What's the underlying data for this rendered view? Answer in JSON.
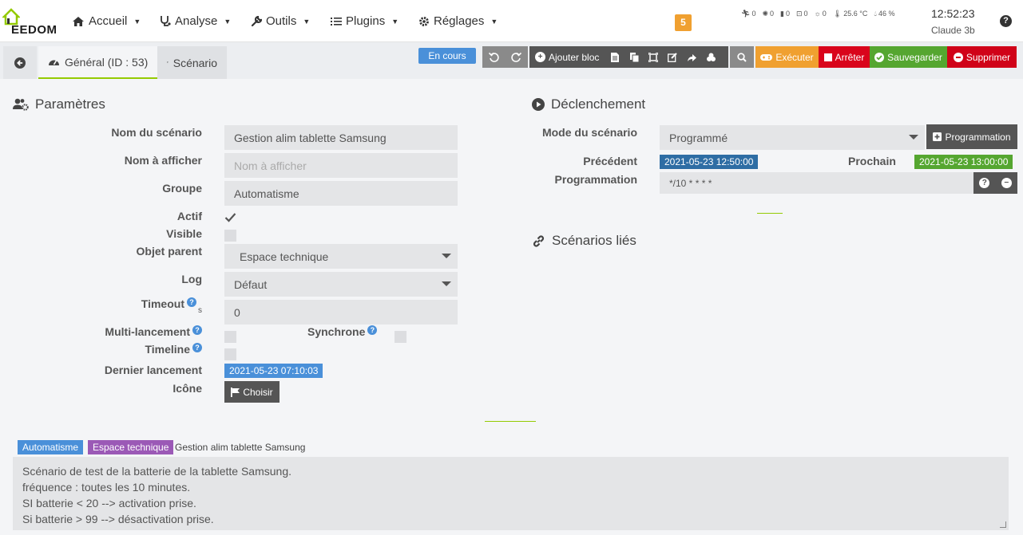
{
  "nav": {
    "logo_text": "EEDOM",
    "items": [
      {
        "label": "Accueil",
        "icon": "home-icon"
      },
      {
        "label": "Analyse",
        "icon": "stethoscope-icon"
      },
      {
        "label": "Outils",
        "icon": "wrench-icon"
      },
      {
        "label": "Plugins",
        "icon": "list-icon"
      },
      {
        "label": "Réglages",
        "icon": "cogs-icon"
      }
    ],
    "message_count": "5",
    "status": [
      {
        "icon": "motion-icon",
        "value": "0"
      },
      {
        "icon": "light-icon",
        "value": "0"
      },
      {
        "icon": "door-icon",
        "value": "0"
      },
      {
        "icon": "window-icon",
        "value": "0"
      },
      {
        "icon": "bulb-icon",
        "value": "0"
      },
      {
        "icon": "thermometer-icon",
        "value": "25.6 °C"
      },
      {
        "icon": "humidity-icon",
        "value": "46 %"
      }
    ],
    "clock": "12:52:23",
    "user": "Claude 3b",
    "help": "?"
  },
  "tabs": {
    "general": "Général (ID : 53)",
    "scenario": "Scénario"
  },
  "toolbar": {
    "state": "En cours",
    "add_block": "Ajouter bloc",
    "execute": "Exécuter",
    "stop": "Arrêter",
    "save": "Sauvegarder",
    "delete": "Supprimer"
  },
  "parametres": {
    "title": "Paramètres",
    "name_label": "Nom du scénario",
    "name_value": "Gestion alim tablette Samsung",
    "display_label": "Nom à afficher",
    "display_placeholder": "Nom à afficher",
    "group_label": "Groupe",
    "group_value": "Automatisme",
    "active_label": "Actif",
    "visible_label": "Visible",
    "parent_label": "Objet parent",
    "parent_value": "Espace technique",
    "log_label": "Log",
    "log_value": "Défaut",
    "timeout_label": "Timeout",
    "timeout_unit": "s",
    "timeout_value": "0",
    "multi_label": "Multi-lancement",
    "sync_label": "Synchrone",
    "timeline_label": "Timeline",
    "last_run_label": "Dernier lancement",
    "last_run_value": "2021-05-23 07:10:03",
    "icon_label": "Icône",
    "icon_button": "Choisir"
  },
  "declenchement": {
    "title": "Déclenchement",
    "mode_label": "Mode du scénario",
    "mode_value": "Programmé",
    "prog_button": "Programmation",
    "prev_label": "Précédent",
    "prev_value": "2021-05-23 12:50:00",
    "next_label": "Prochain",
    "next_value": "2021-05-23 13:00:00",
    "cron_label": "Programmation",
    "cron_value": "*/10 * * * *"
  },
  "linked": {
    "title": "Scénarios liés"
  },
  "footer": {
    "tag_group": "Automatisme",
    "tag_object": "Espace technique",
    "name": "Gestion alim tablette Samsung",
    "description": [
      "Scénario de test de la batterie de la tablette Samsung.",
      "fréquence : toutes les 10 minutes.",
      "SI batterie < 20 --> activation prise.",
      "Si batterie > 99 --> désactivation prise."
    ]
  },
  "colors": {
    "accent_green": "#94ca02",
    "blue": "#4a90d9",
    "orange": "#f0a030",
    "red": "#d9041b",
    "green": "#55a630",
    "purple": "#9b59b6"
  }
}
